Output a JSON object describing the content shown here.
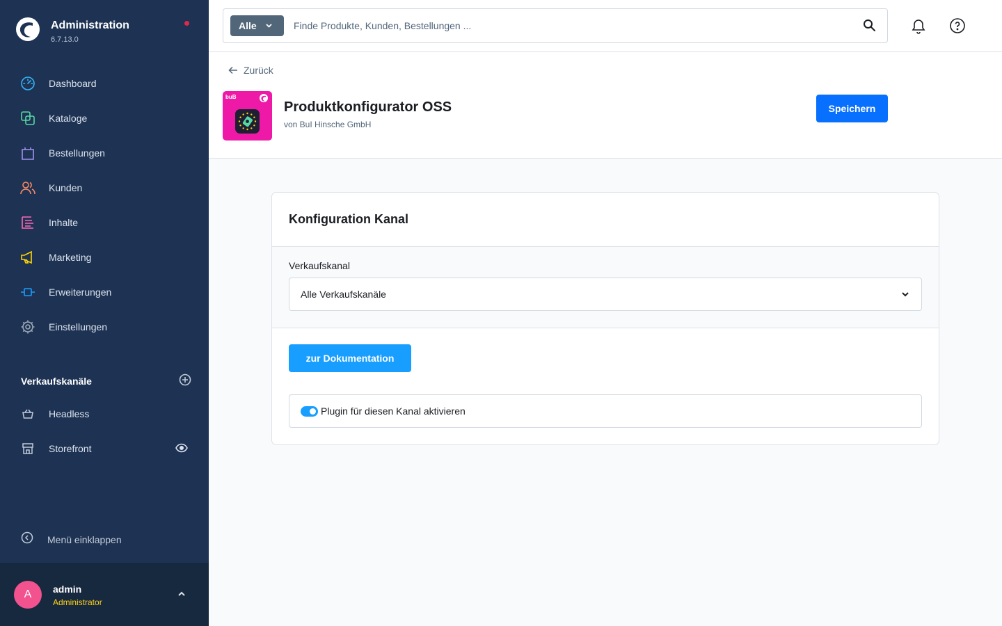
{
  "brand": {
    "title": "Administration",
    "version": "6.7.13.0"
  },
  "nav": [
    {
      "label": "Dashboard",
      "icon": "gauge-icon",
      "color": "#34b5f7"
    },
    {
      "label": "Kataloge",
      "icon": "catalog-icon",
      "color": "#57d9a3"
    },
    {
      "label": "Bestellungen",
      "icon": "shopping-bag-icon",
      "color": "#a092f0"
    },
    {
      "label": "Kunden",
      "icon": "users-icon",
      "color": "#f88962"
    },
    {
      "label": "Inhalte",
      "icon": "content-icon",
      "color": "#ff68b4"
    },
    {
      "label": "Marketing",
      "icon": "megaphone-icon",
      "color": "#ffd700"
    },
    {
      "label": "Erweiterungen",
      "icon": "plug-icon",
      "color": "#189eff"
    },
    {
      "label": "Einstellungen",
      "icon": "gear-icon",
      "color": "#9aa8b5"
    }
  ],
  "sales_channels": {
    "title": "Verkaufskanäle",
    "items": [
      {
        "label": "Headless",
        "icon": "basket-icon"
      },
      {
        "label": "Storefront",
        "icon": "storefront-icon"
      }
    ]
  },
  "collapse_label": "Menü einklappen",
  "user": {
    "initial": "A",
    "name": "admin",
    "role": "Administrator"
  },
  "search": {
    "type_label": "Alle",
    "placeholder": "Finde Produkte, Kunden, Bestellungen ..."
  },
  "header": {
    "back_label": "Zurück",
    "plugin_name": "Produktkonfigurator OSS",
    "plugin_author": "von BuI Hinsche GmbH",
    "icon_label": "buB",
    "save_label": "Speichern"
  },
  "card": {
    "title": "Konfiguration Kanal",
    "field_label": "Verkaufskanal",
    "select_value": "Alle Verkaufskanäle",
    "doc_button": "zur Dokumentation",
    "toggle_label": "Plugin für diesen Kanal aktivieren",
    "toggle_on": true
  },
  "colors": {
    "sidebar": "#1e3354",
    "primary": "#0870ff",
    "accent": "#189eff",
    "plugin_icon": "#ee1aa7"
  }
}
